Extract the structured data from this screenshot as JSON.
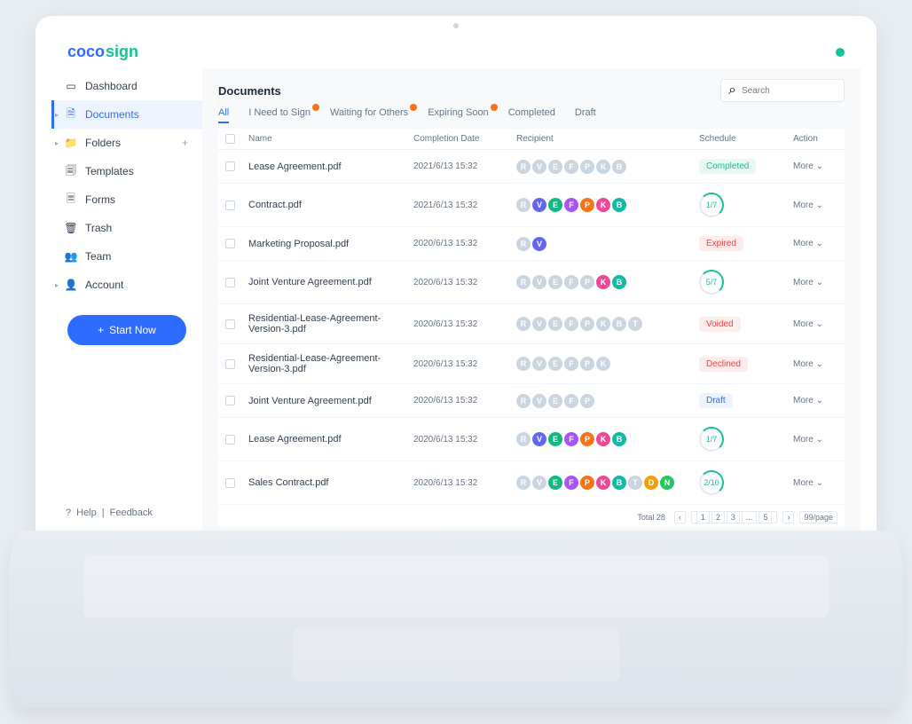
{
  "logo": {
    "part1": "coco",
    "part2": "sign"
  },
  "search": {
    "placeholder": "Search"
  },
  "pageTitle": "Documents",
  "sidebar": {
    "items": [
      {
        "label": "Dashboard",
        "icon": "▭"
      },
      {
        "label": "Documents",
        "icon": "🗎",
        "active": true,
        "arrow": true
      },
      {
        "label": "Folders",
        "icon": "📁",
        "arrow": true,
        "plus": true
      },
      {
        "label": "Templates",
        "icon": "🗐"
      },
      {
        "label": "Forms",
        "icon": "🗏"
      },
      {
        "label": "Trash",
        "icon": "🗑"
      },
      {
        "label": "Team",
        "icon": "👥"
      },
      {
        "label": "Account",
        "icon": "👤",
        "arrow": true
      }
    ],
    "startBtn": "Start Now",
    "help": "Help",
    "feedback": "Feedback"
  },
  "tabs": [
    {
      "label": "All",
      "active": true
    },
    {
      "label": "I Need to Sign",
      "badge": true
    },
    {
      "label": "Waiting for Others",
      "badge": true
    },
    {
      "label": "Expiring Soon",
      "badge": true
    },
    {
      "label": "Completed"
    },
    {
      "label": "Draft"
    }
  ],
  "cols": {
    "name": "Name",
    "date": "Completion Date",
    "recipient": "Recipient",
    "schedule": "Schedule",
    "action": "Action"
  },
  "more": "More",
  "avatarColors": {
    "R": "#cbd5e1",
    "V": "#6366f1",
    "E": "#10b981",
    "F": "#a855f7",
    "P": "#f97316",
    "K": "#ec4899",
    "B": "#14b8a6",
    "T": "#cbd5e1",
    "D": "#f59e0b",
    "N": "#22c55e"
  },
  "graySet": [
    "R",
    "V",
    "E",
    "F",
    "P",
    "K",
    "B",
    "T"
  ],
  "rows": [
    {
      "name": "Lease Agreement.pdf",
      "date": "2021/6/13  15:32",
      "recips": [
        "R",
        "V",
        "E",
        "F",
        "P",
        "K",
        "B"
      ],
      "gray": true,
      "schedule": {
        "type": "badge",
        "text": "Completed",
        "cls": "s-completed"
      }
    },
    {
      "name": "Contract.pdf",
      "date": "2021/6/13  15:32",
      "recips": [
        "R",
        "V",
        "E",
        "F",
        "P",
        "K",
        "B"
      ],
      "grayFirst": 1,
      "schedule": {
        "type": "ring",
        "text": "1/7"
      }
    },
    {
      "name": "Marketing Proposal.pdf",
      "date": "2020/6/13  15:32",
      "recips": [
        "R",
        "V"
      ],
      "grayFirst": 1,
      "schedule": {
        "type": "badge",
        "text": "Expired",
        "cls": "s-expired"
      }
    },
    {
      "name": "Joint Venture Agreement.pdf",
      "date": "2020/6/13  15:32",
      "recips": [
        "R",
        "V",
        "E",
        "F",
        "P",
        "K",
        "B"
      ],
      "gray": true,
      "colorIdx": [
        5,
        6
      ],
      "schedule": {
        "type": "ring",
        "text": "5/7"
      }
    },
    {
      "name": "Residential-Lease-Agreement-Version-3.pdf",
      "date": "2020/6/13  15:32",
      "recips": [
        "R",
        "V",
        "E",
        "F",
        "P",
        "K",
        "B",
        "T"
      ],
      "gray": true,
      "schedule": {
        "type": "badge",
        "text": "Voided",
        "cls": "s-voided"
      }
    },
    {
      "name": "Residential-Lease-Agreement-Version-3.pdf",
      "date": "2020/6/13  15:32",
      "recips": [
        "R",
        "V",
        "E",
        "F",
        "P",
        "K"
      ],
      "gray": true,
      "schedule": {
        "type": "badge",
        "text": "Declined",
        "cls": "s-declined"
      }
    },
    {
      "name": "Joint Venture Agreement.pdf",
      "date": "2020/6/13  15:32",
      "recips": [
        "R",
        "V",
        "E",
        "F",
        "P"
      ],
      "gray": true,
      "schedule": {
        "type": "badge",
        "text": "Draft",
        "cls": "s-draft"
      }
    },
    {
      "name": "Lease Agreement.pdf",
      "date": "2020/6/13  15:32",
      "recips": [
        "R",
        "V",
        "E",
        "F",
        "P",
        "K",
        "B"
      ],
      "grayFirst": 1,
      "schedule": {
        "type": "ring",
        "text": "1/7"
      }
    },
    {
      "name": "Sales Contract.pdf",
      "date": "2020/6/13  15:32",
      "recips": [
        "R",
        "V",
        "E",
        "F",
        "P",
        "K",
        "B",
        "T",
        "D",
        "N"
      ],
      "grayFirst": 2,
      "schedule": {
        "type": "ring",
        "text": "2/10"
      }
    }
  ],
  "pager": {
    "total": "Total 28",
    "pages": [
      "1",
      "2",
      "3",
      "...",
      "5"
    ],
    "perPage": "99/page"
  }
}
